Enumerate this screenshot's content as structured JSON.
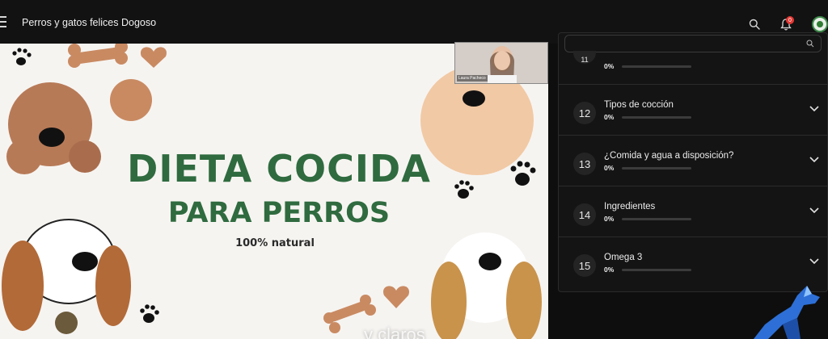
{
  "header": {
    "course_title": "Perros y gatos felices Dogoso",
    "notification_count": "0"
  },
  "slide": {
    "title_line1": "DIETA COCIDA",
    "title_line2": "PARA PERROS",
    "subtitle": "100% natural",
    "caption": "y claros"
  },
  "webcam": {
    "name": "Laura Pacheco"
  },
  "panel": {
    "items": [
      {
        "number": "11",
        "title": "",
        "percent": "0%",
        "progress": 0
      },
      {
        "number": "12",
        "title": "Tipos de cocción",
        "percent": "0%",
        "progress": 0
      },
      {
        "number": "13",
        "title": "¿Comida y agua a disposición?",
        "percent": "0%",
        "progress": 0
      },
      {
        "number": "14",
        "title": "Ingredientes",
        "percent": "0%",
        "progress": 0
      },
      {
        "number": "15",
        "title": "Omega 3",
        "percent": "0%",
        "progress": 0
      }
    ]
  },
  "colors": {
    "accent_green": "#2f6b3f",
    "badge_red": "#e53935",
    "progress_green": "#4caf50"
  },
  "icons": {
    "menu": "menu-icon",
    "search": "search-icon",
    "bell": "bell-icon",
    "chevron": "chevron-down-icon"
  }
}
